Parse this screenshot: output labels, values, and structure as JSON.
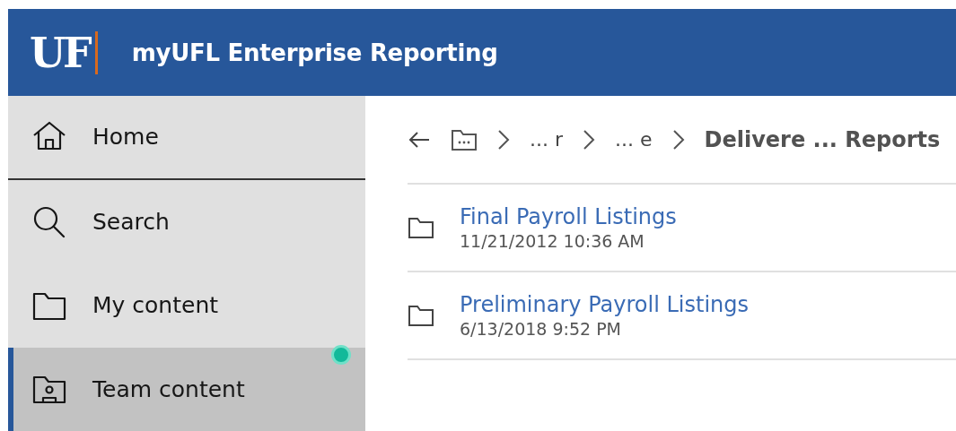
{
  "header": {
    "logo": "UF",
    "title": "myUFL Enterprise Reporting"
  },
  "sidebar": {
    "items": [
      {
        "label": "Home",
        "selected": false
      },
      {
        "label": "Search",
        "selected": false
      },
      {
        "label": "My content",
        "selected": false
      },
      {
        "label": "Team content",
        "selected": true
      }
    ]
  },
  "breadcrumb": {
    "items": [
      "... r",
      "... e"
    ],
    "current": "Delivere ... Reports"
  },
  "folders": [
    {
      "name": "Final Payroll Listings",
      "modified": "11/21/2012 10:36 AM"
    },
    {
      "name": "Preliminary Payroll Listings",
      "modified": "6/13/2018 9:52 PM"
    }
  ]
}
